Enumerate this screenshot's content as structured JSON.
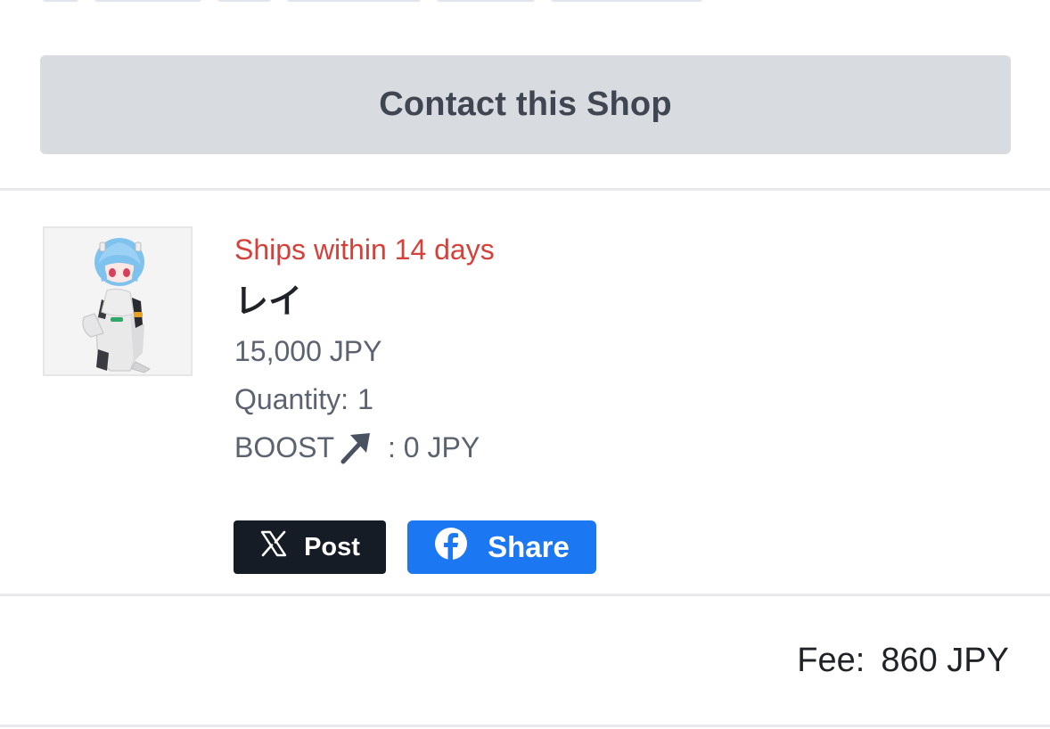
{
  "contact_button": {
    "label": "Contact this Shop"
  },
  "item": {
    "shipping_note": "Ships within 14 days",
    "title": "レイ",
    "price": "15,000 JPY",
    "quantity_label": "Quantity:",
    "quantity_value": "1",
    "boost_label": "BOOST",
    "boost_value": ": 0 JPY",
    "thumbnail_icon": "figure-image"
  },
  "share": {
    "x_label": "Post",
    "x_icon": "x-logo-icon",
    "fb_label": "Share",
    "fb_icon": "facebook-icon"
  },
  "fee": {
    "label": "Fee:",
    "value": "860 JPY"
  },
  "colors": {
    "ship_text": "#d6403a",
    "contact_bg": "#d8dbe0",
    "x_button": "#161c26",
    "fb_button": "#1b77f2"
  }
}
